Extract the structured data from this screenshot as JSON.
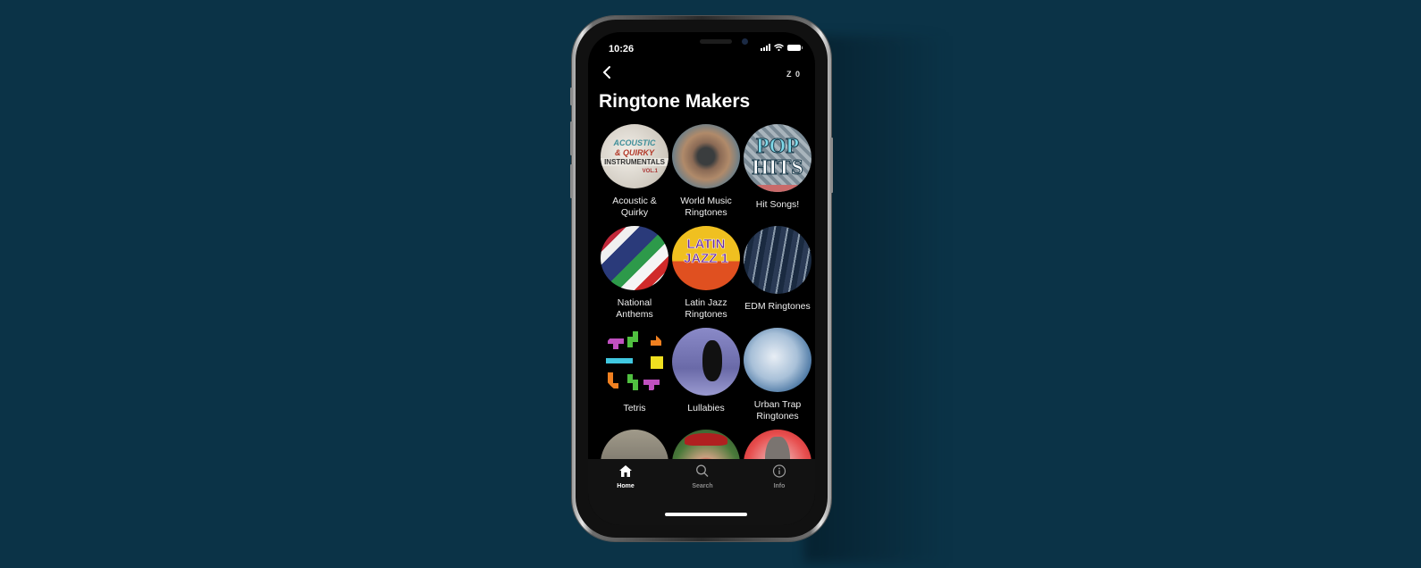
{
  "status_bar": {
    "time": "10:26"
  },
  "nav": {
    "back_icon": "chevron-left-icon",
    "back_glyph": "‹",
    "counter_text": "Z 0"
  },
  "page": {
    "title": "Ringtone Makers"
  },
  "collections": [
    {
      "label": "Acoustic & Quirky",
      "art": "Acoustic & Quirky Instrumentals Vol.1"
    },
    {
      "label": "World Music Ringtones",
      "art": ""
    },
    {
      "label": "Hit Songs!",
      "art": "POP HITS"
    },
    {
      "label": "National Anthems",
      "art": ""
    },
    {
      "label": "Latin Jazz Ringtones",
      "art": "LATIN JAZZ 1"
    },
    {
      "label": "EDM Ringtones",
      "art": ""
    },
    {
      "label": "Tetris",
      "art": ""
    },
    {
      "label": "Lullabies",
      "art": ""
    },
    {
      "label": "Urban Trap Ringtones",
      "art": ""
    },
    {
      "label": "",
      "art": ""
    },
    {
      "label": "",
      "art": ""
    },
    {
      "label": "",
      "art": ""
    }
  ],
  "tab_bar": {
    "tabs": [
      {
        "label": "Home",
        "icon": "home-icon",
        "active": true
      },
      {
        "label": "Search",
        "icon": "search-icon",
        "active": false
      },
      {
        "label": "Info",
        "icon": "info-icon",
        "active": false
      }
    ],
    "active_color": "#ffffff",
    "inactive_color": "#8a8a8a"
  },
  "colors": {
    "background": "#0b3347",
    "screen": "#000000",
    "tab_bar": "#121212"
  }
}
